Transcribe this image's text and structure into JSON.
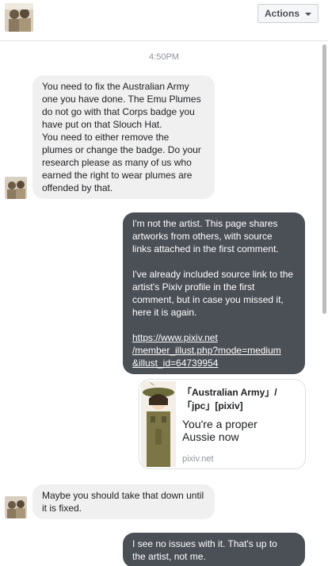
{
  "header": {
    "actions_label": "Actions"
  },
  "thread": {
    "timestamp": "4:50PM",
    "messages": [
      {
        "from": "them",
        "paragraphs": [
          "You need to fix the Australian Army\none you have done. The Emu Plumes\ndo not go with that Corps badge you\nhave put on that Slouch Hat.",
          "You need to either remove the\nplumes or change the badge. Do your\nresearch please as many of us who\nearned the right to wear plumes are\noffended by that."
        ]
      },
      {
        "from": "me",
        "paragraphs": [
          "I'm not the artist. This page shares\nartworks from others, with source\nlinks attached in the first comment.",
          "I've already included source link to the\nartist's Pixiv profile in the first\ncomment, but in case you missed it,\nhere it is again."
        ],
        "link": "https://www.pixiv.net\n/member_illust.php?mode=medium\n&illust_id=64739954"
      },
      {
        "from": "link_card",
        "title": "「Australian Army」/\n「jpc」[pixiv]",
        "description": "You're a proper\nAussie now",
        "domain": "pixiv.net"
      },
      {
        "from": "them",
        "paragraphs": [
          "Maybe you should take that down until\nit is fixed."
        ]
      },
      {
        "from": "me",
        "paragraphs": [
          "I see no issues with it. That's up to\nthe artist, not me."
        ]
      }
    ]
  },
  "colors": {
    "incoming_bubble": "#f1f0f0",
    "outgoing_bubble": "#4b4f56",
    "timestamp": "#90949c"
  },
  "icons": {
    "avatar": "user-avatar",
    "actions_caret": "chevron-down-icon"
  }
}
